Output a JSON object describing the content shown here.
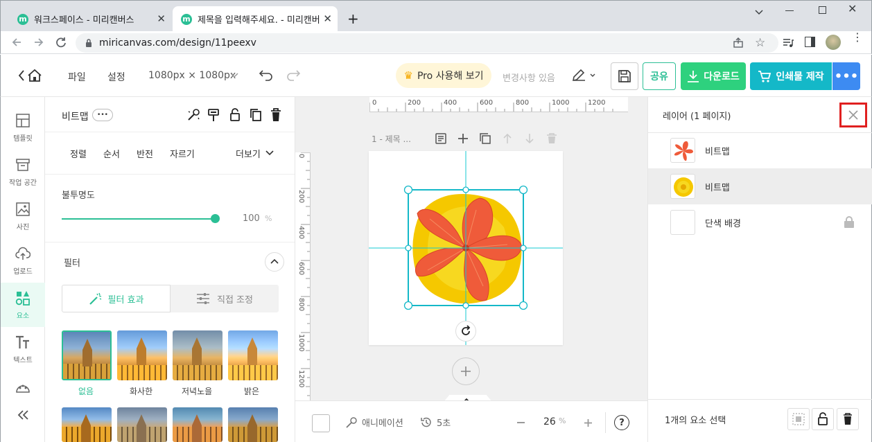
{
  "browser": {
    "tabs": [
      {
        "favicon": "m",
        "title": "워크스페이스 - 미리캔버스"
      },
      {
        "favicon": "m",
        "title": "제목을 입력해주세요. - 미리캔버"
      }
    ],
    "url": "miricanvas.com/design/11peexv"
  },
  "header": {
    "file": "파일",
    "settings": "설정",
    "size": "1080px × 1080px",
    "pro": "Pro 사용해 보기",
    "changes": "변경사항 있음",
    "share": "공유",
    "download": "다운로드",
    "print": "인쇄물 제작"
  },
  "rail": [
    {
      "icon": "template-icon",
      "label": "템플릿"
    },
    {
      "icon": "workspace-icon",
      "label": "작업 공간"
    },
    {
      "icon": "photo-icon",
      "label": "사진"
    },
    {
      "icon": "upload-icon",
      "label": "업로드"
    },
    {
      "icon": "elements-icon",
      "label": "요소"
    },
    {
      "icon": "text-icon",
      "label": "텍스트"
    },
    {
      "icon": "palette-icon",
      "label": ""
    }
  ],
  "panel": {
    "title": "비트맵",
    "more_badge": "•••",
    "menu": [
      "정렬",
      "순서",
      "반전",
      "자르기"
    ],
    "more": "더보기",
    "opacity_label": "불투명도",
    "opacity_value": "100",
    "opacity_unit": "%",
    "filter_label": "필터",
    "filter_tabs": [
      "필터 효과",
      "직접 조정"
    ],
    "filters": [
      "없음",
      "화사한",
      "저녁노을",
      "밝은"
    ]
  },
  "canvas": {
    "page_label": "1 - 제목 ...",
    "ruler_top": [
      "0",
      "200",
      "400",
      "600",
      "800",
      "1000",
      "1200"
    ],
    "ruler_left": [
      "0",
      "200",
      "400",
      "600",
      "800",
      "1000",
      "1200"
    ]
  },
  "bottom": {
    "animation": "애니메이션",
    "duration": "5초",
    "zoom": "26",
    "zoom_unit": "%"
  },
  "layers": {
    "title": "레이어 (1 페이지)",
    "items": [
      "비트맵",
      "비트맵",
      "단색 배경"
    ],
    "selection": "1개의 요소 선택"
  },
  "colors": {
    "accent": "#2bbf95",
    "teal": "#14b8c8",
    "highlight_red": "#e02020"
  }
}
